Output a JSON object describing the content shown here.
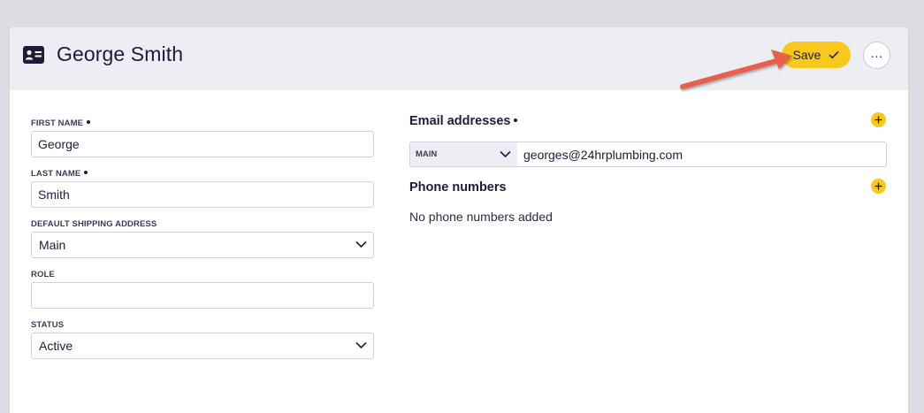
{
  "header": {
    "title": "George Smith",
    "save_label": "Save",
    "more_label": "···"
  },
  "form": {
    "first_name": {
      "label": "FIRST NAME",
      "value": "George",
      "required": true
    },
    "last_name": {
      "label": "LAST NAME",
      "value": "Smith",
      "required": true
    },
    "default_shipping_address": {
      "label": "DEFAULT SHIPPING ADDRESS",
      "value": "Main"
    },
    "role": {
      "label": "ROLE",
      "value": ""
    },
    "status": {
      "label": "STATUS",
      "value": "Active"
    }
  },
  "email": {
    "title": "Email addresses",
    "required": true,
    "items": [
      {
        "type": "MAIN",
        "value": "georges@24hrplumbing.com"
      }
    ]
  },
  "phone": {
    "title": "Phone numbers",
    "empty_text": "No phone numbers added"
  },
  "colors": {
    "accent": "#f8c81c",
    "header_bg": "#eceef4",
    "text": "#1d1d3a",
    "annotation_arrow": "#e8604c"
  },
  "icons": {
    "title_icon": "contact-card-icon",
    "save_icon": "checkmark-icon",
    "add_icon": "plus-icon",
    "dropdown_icon": "chevron-down-icon"
  }
}
